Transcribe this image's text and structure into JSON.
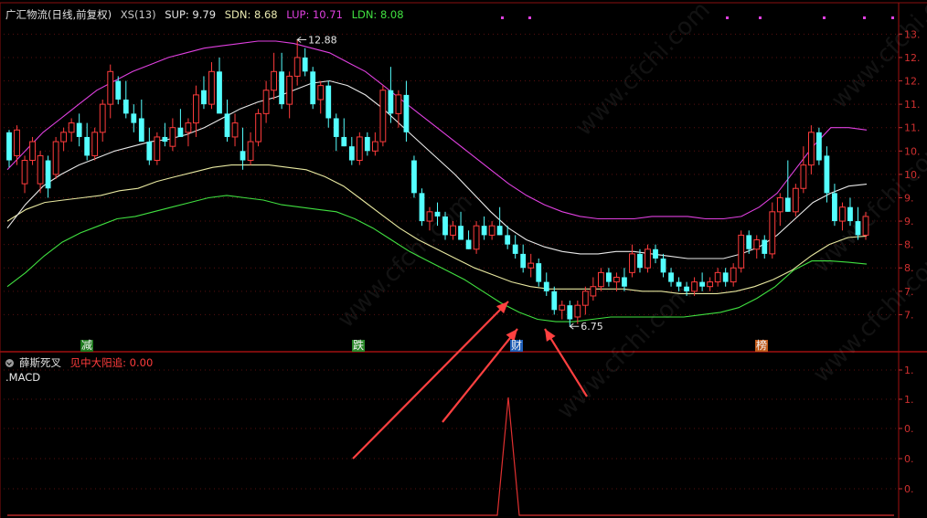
{
  "header": {
    "stock_name": "广汇物流(日线,前复权)",
    "indicators": [
      {
        "label": "XS(13)",
        "color": "#c8c8c8"
      },
      {
        "label": "SUP: 9.79",
        "color": "#e8e8e8"
      },
      {
        "label": "SDN: 8.68",
        "color": "#e8e8b0"
      },
      {
        "label": "LUP: 10.71",
        "color": "#e040e0"
      },
      {
        "label": "LDN: 8.08",
        "color": "#40e040"
      }
    ]
  },
  "sub_header": {
    "name": "薛斯死叉",
    "signal_label": "见中大阳追: 0.00",
    "macd_label": ".MACD"
  },
  "annotations": {
    "high_marker": "12.88",
    "low_marker": "6.75"
  },
  "event_tags": [
    {
      "text": "减",
      "bg": "#1e7a1e",
      "fg": "#f0f0f0"
    },
    {
      "text": "跌",
      "bg": "#2a8a2a",
      "fg": "#f0f0f0"
    },
    {
      "text": "财",
      "bg": "#1f5fb8",
      "fg": "#f0f0f0"
    },
    {
      "text": "榜",
      "bg": "#c05a1a",
      "fg": "#f0f0f0"
    }
  ],
  "watermark": "www.cfchi.com",
  "chart_data": [
    {
      "type": "candlestick",
      "title": "广汇物流(日线,前复权)",
      "y_tick_labels": [
        "13.",
        "12.",
        "12.",
        "11.",
        "11.",
        "10.",
        "10.",
        "9.",
        "9.",
        "8.",
        "8.",
        "7.",
        "7."
      ],
      "ylim": [
        6.5,
        13.3
      ],
      "colors": {
        "up": "#ff3c3c",
        "down": "#54ffff",
        "LUP": "#e040e0",
        "SUP": "#e8e8e8",
        "SDN": "#e8e8a0",
        "LDN": "#40e040"
      },
      "candles": [
        [
          10.9,
          10.95,
          10.15,
          10.3
        ],
        [
          10.4,
          11.05,
          10.2,
          10.95
        ],
        [
          9.8,
          10.4,
          9.6,
          10.3
        ],
        [
          10.3,
          10.8,
          10.2,
          10.7
        ],
        [
          9.8,
          10.5,
          9.6,
          10.4
        ],
        [
          10.3,
          10.4,
          9.5,
          9.7
        ],
        [
          10.0,
          10.8,
          9.9,
          10.7
        ],
        [
          10.7,
          11.0,
          10.5,
          10.9
        ],
        [
          10.9,
          11.2,
          10.7,
          11.1
        ],
        [
          11.1,
          11.3,
          10.6,
          10.8
        ],
        [
          10.8,
          11.1,
          10.3,
          10.4
        ],
        [
          10.4,
          11.0,
          10.3,
          10.9
        ],
        [
          10.9,
          11.6,
          10.7,
          11.5
        ],
        [
          11.5,
          12.35,
          11.2,
          12.2
        ],
        [
          12.0,
          12.1,
          11.5,
          11.6
        ],
        [
          11.6,
          12.0,
          11.2,
          11.3
        ],
        [
          11.3,
          11.5,
          10.9,
          11.1
        ],
        [
          11.2,
          11.6,
          10.8,
          10.7
        ],
        [
          10.7,
          11.0,
          10.2,
          10.3
        ],
        [
          10.3,
          10.9,
          10.2,
          10.8
        ],
        [
          10.8,
          11.1,
          10.6,
          10.7
        ],
        [
          10.6,
          11.2,
          10.5,
          11.0
        ],
        [
          11.0,
          11.4,
          10.9,
          10.8
        ],
        [
          10.9,
          11.2,
          10.6,
          11.1
        ],
        [
          11.1,
          11.9,
          10.8,
          11.7
        ],
        [
          11.8,
          12.1,
          11.4,
          11.5
        ],
        [
          11.5,
          12.4,
          11.4,
          12.2
        ],
        [
          12.2,
          12.5,
          11.6,
          11.3
        ],
        [
          11.3,
          11.6,
          10.7,
          10.8
        ],
        [
          10.8,
          11.3,
          10.6,
          11.1
        ],
        [
          10.5,
          11.0,
          10.1,
          10.3
        ],
        [
          10.3,
          10.9,
          10.2,
          10.7
        ],
        [
          10.7,
          11.4,
          10.6,
          11.3
        ],
        [
          11.3,
          12.0,
          11.1,
          11.8
        ],
        [
          11.8,
          12.6,
          11.6,
          12.2
        ],
        [
          12.2,
          12.6,
          11.4,
          11.5
        ],
        [
          11.5,
          12.2,
          11.2,
          12.1
        ],
        [
          12.1,
          12.88,
          11.9,
          12.5
        ],
        [
          12.5,
          12.7,
          12.1,
          12.2
        ],
        [
          12.2,
          12.3,
          11.4,
          11.5
        ],
        [
          11.6,
          12.0,
          11.3,
          11.9
        ],
        [
          11.9,
          12.0,
          11.0,
          11.2
        ],
        [
          11.2,
          11.3,
          10.5,
          10.8
        ],
        [
          10.8,
          11.2,
          10.6,
          10.6
        ],
        [
          10.6,
          10.8,
          10.2,
          10.3
        ],
        [
          10.3,
          10.9,
          10.2,
          10.8
        ],
        [
          10.8,
          10.9,
          10.4,
          10.5
        ],
        [
          10.5,
          10.9,
          10.4,
          10.7
        ],
        [
          10.7,
          11.9,
          10.6,
          11.8
        ],
        [
          11.8,
          12.3,
          11.1,
          11.3
        ],
        [
          11.3,
          11.8,
          11.0,
          11.7
        ],
        [
          11.7,
          12.0,
          10.7,
          10.9
        ],
        [
          10.3,
          10.4,
          9.5,
          9.6
        ],
        [
          9.6,
          9.7,
          8.9,
          9.0
        ],
        [
          9.0,
          9.3,
          8.8,
          9.2
        ],
        [
          9.2,
          9.4,
          8.9,
          9.1
        ],
        [
          9.1,
          9.2,
          8.6,
          8.7
        ],
        [
          8.7,
          9.0,
          8.6,
          8.9
        ],
        [
          8.9,
          9.2,
          8.7,
          8.6
        ],
        [
          8.6,
          8.8,
          8.4,
          8.4
        ],
        [
          8.4,
          9.0,
          8.3,
          8.9
        ],
        [
          8.9,
          9.1,
          8.6,
          8.7
        ],
        [
          8.7,
          9.0,
          8.6,
          8.9
        ],
        [
          8.9,
          9.3,
          8.7,
          8.7
        ],
        [
          8.7,
          8.9,
          8.4,
          8.5
        ],
        [
          8.5,
          8.7,
          8.2,
          8.3
        ],
        [
          8.3,
          8.5,
          7.9,
          8.0
        ],
        [
          8.0,
          8.3,
          7.8,
          8.1
        ],
        [
          8.1,
          8.2,
          7.6,
          7.7
        ],
        [
          7.7,
          7.9,
          7.4,
          7.5
        ],
        [
          7.5,
          7.6,
          7.0,
          7.1
        ],
        [
          7.1,
          7.3,
          6.9,
          7.2
        ],
        [
          7.2,
          7.3,
          6.75,
          6.9
        ],
        [
          6.95,
          7.3,
          6.8,
          7.2
        ],
        [
          7.2,
          7.6,
          7.0,
          7.5
        ],
        [
          7.4,
          7.8,
          7.3,
          7.6
        ],
        [
          7.6,
          8.0,
          7.5,
          7.9
        ],
        [
          7.9,
          8.0,
          7.6,
          7.7
        ],
        [
          7.7,
          7.9,
          7.5,
          7.8
        ],
        [
          7.8,
          8.0,
          7.5,
          7.6
        ],
        [
          7.9,
          8.5,
          7.8,
          8.3
        ],
        [
          8.3,
          8.4,
          7.9,
          8.0
        ],
        [
          8.0,
          8.5,
          7.9,
          8.4
        ],
        [
          8.4,
          8.5,
          8.1,
          8.2
        ],
        [
          8.2,
          8.3,
          7.8,
          7.9
        ],
        [
          7.9,
          8.0,
          7.6,
          7.7
        ],
        [
          7.7,
          7.8,
          7.5,
          7.6
        ],
        [
          7.6,
          7.7,
          7.4,
          7.5
        ],
        [
          7.5,
          7.8,
          7.4,
          7.7
        ],
        [
          7.7,
          7.9,
          7.5,
          7.6
        ],
        [
          7.6,
          7.8,
          7.5,
          7.7
        ],
        [
          7.7,
          8.0,
          7.6,
          7.9
        ],
        [
          7.9,
          8.0,
          7.6,
          7.7
        ],
        [
          7.7,
          8.1,
          7.6,
          8.0
        ],
        [
          8.0,
          8.8,
          7.9,
          8.7
        ],
        [
          8.7,
          8.8,
          8.3,
          8.4
        ],
        [
          8.4,
          8.7,
          8.2,
          8.6
        ],
        [
          8.6,
          8.7,
          8.2,
          8.3
        ],
        [
          8.3,
          9.4,
          8.2,
          9.2
        ],
        [
          9.2,
          9.6,
          8.9,
          9.5
        ],
        [
          9.5,
          10.3,
          9.2,
          9.2
        ],
        [
          9.2,
          9.8,
          9.1,
          9.7
        ],
        [
          9.7,
          10.6,
          9.6,
          10.2
        ],
        [
          10.2,
          11.05,
          10.0,
          10.9
        ],
        [
          10.9,
          11.0,
          10.2,
          10.3
        ],
        [
          10.4,
          10.6,
          9.4,
          9.6
        ],
        [
          9.6,
          9.8,
          8.9,
          9.0
        ],
        [
          9.0,
          9.4,
          8.8,
          9.3
        ],
        [
          9.3,
          9.5,
          8.9,
          9.0
        ],
        [
          9.0,
          9.3,
          8.6,
          8.7
        ],
        [
          8.7,
          9.2,
          8.6,
          9.1
        ]
      ],
      "lines": {
        "LUP": [
          10.1,
          10.5,
          10.9,
          11.2,
          11.5,
          11.8,
          12.0,
          12.2,
          12.35,
          12.5,
          12.6,
          12.7,
          12.75,
          12.8,
          12.85,
          12.85,
          12.8,
          12.7,
          12.6,
          12.4,
          12.2,
          11.9,
          11.6,
          11.3,
          11.0,
          10.7,
          10.4,
          10.1,
          9.8,
          9.55,
          9.35,
          9.2,
          9.1,
          9.05,
          9.05,
          9.05,
          9.1,
          9.1,
          9.1,
          9.05,
          9.05,
          9.1,
          9.3,
          9.6,
          10.1,
          10.6,
          11.0,
          11.0,
          10.95
        ],
        "SUP": [
          8.85,
          9.35,
          9.75,
          10.0,
          10.2,
          10.35,
          10.5,
          10.6,
          10.7,
          10.75,
          10.85,
          11.0,
          11.2,
          11.4,
          11.55,
          11.65,
          11.8,
          11.95,
          12.0,
          11.9,
          11.7,
          11.4,
          11.05,
          10.7,
          10.35,
          10.0,
          9.6,
          9.2,
          8.85,
          8.6,
          8.45,
          8.35,
          8.3,
          8.3,
          8.35,
          8.35,
          8.3,
          8.25,
          8.2,
          8.2,
          8.2,
          8.3,
          8.45,
          8.7,
          9.05,
          9.4,
          9.6,
          9.75,
          9.79
        ],
        "SDN": [
          9.0,
          9.25,
          9.4,
          9.45,
          9.5,
          9.55,
          9.65,
          9.7,
          9.85,
          9.95,
          10.05,
          10.15,
          10.2,
          10.2,
          10.2,
          10.15,
          10.1,
          9.95,
          9.75,
          9.45,
          9.15,
          8.85,
          8.6,
          8.4,
          8.2,
          8.0,
          7.85,
          7.7,
          7.6,
          7.55,
          7.55,
          7.55,
          7.55,
          7.55,
          7.5,
          7.5,
          7.45,
          7.45,
          7.45,
          7.5,
          7.6,
          7.75,
          7.95,
          8.25,
          8.5,
          8.65,
          8.68
        ],
        "LDN": [
          7.6,
          7.9,
          8.25,
          8.55,
          8.75,
          8.9,
          9.05,
          9.1,
          9.2,
          9.3,
          9.4,
          9.5,
          9.55,
          9.5,
          9.45,
          9.35,
          9.3,
          9.25,
          9.2,
          9.05,
          8.85,
          8.6,
          8.35,
          8.15,
          7.95,
          7.75,
          7.5,
          7.25,
          7.05,
          6.9,
          6.85,
          6.85,
          6.9,
          6.95,
          6.95,
          6.95,
          6.95,
          6.95,
          7.0,
          7.05,
          7.15,
          7.35,
          7.6,
          7.95,
          8.15,
          8.15,
          8.12,
          8.08
        ]
      }
    },
    {
      "type": "line",
      "title": "薛斯死叉",
      "series": [
        {
          "name": "见中大阳追",
          "values": [
            0,
            0,
            0,
            0,
            0,
            0,
            0,
            0,
            0,
            0,
            0,
            1,
            0,
            0,
            0,
            0,
            0,
            0,
            0,
            0,
            0,
            0,
            0,
            0
          ]
        }
      ],
      "y_tick_labels": [
        "1.",
        "1.",
        "0.",
        "0.",
        "0.",
        "0."
      ],
      "ylim": [
        0,
        1.25
      ]
    }
  ]
}
